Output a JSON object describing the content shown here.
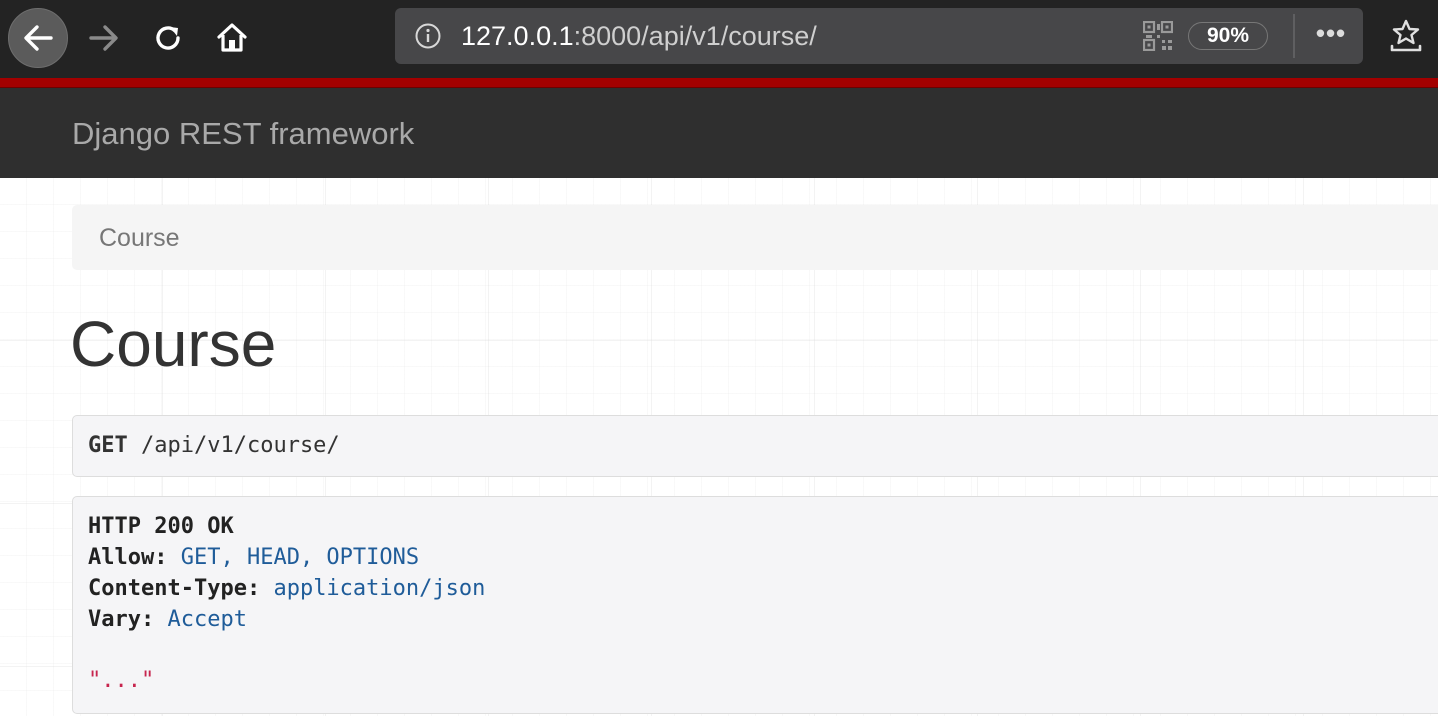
{
  "browser": {
    "url_host": "127.0.0.1",
    "url_rest": ":8000/api/v1/course/",
    "zoom": "90%",
    "icons": {
      "back": "arrow-left-icon",
      "forward": "arrow-right-icon",
      "reload": "reload-icon",
      "home": "home-icon",
      "info": "info-icon",
      "qr": "qr-code-icon",
      "more": "more-icon",
      "pocket": "pocket-icon"
    },
    "accent_color": "#a30000"
  },
  "navbar": {
    "brand": "Django REST framework"
  },
  "breadcrumb": {
    "items": [
      "Course"
    ]
  },
  "page": {
    "title": "Course"
  },
  "request": {
    "method": "GET",
    "path": "/api/v1/course/"
  },
  "response": {
    "status": "HTTP 200 OK",
    "headers": [
      {
        "key": "Allow",
        "value": "GET, HEAD, OPTIONS"
      },
      {
        "key": "Content-Type",
        "value": "application/json"
      },
      {
        "key": "Vary",
        "value": "Accept"
      }
    ],
    "body": "\"...\""
  }
}
